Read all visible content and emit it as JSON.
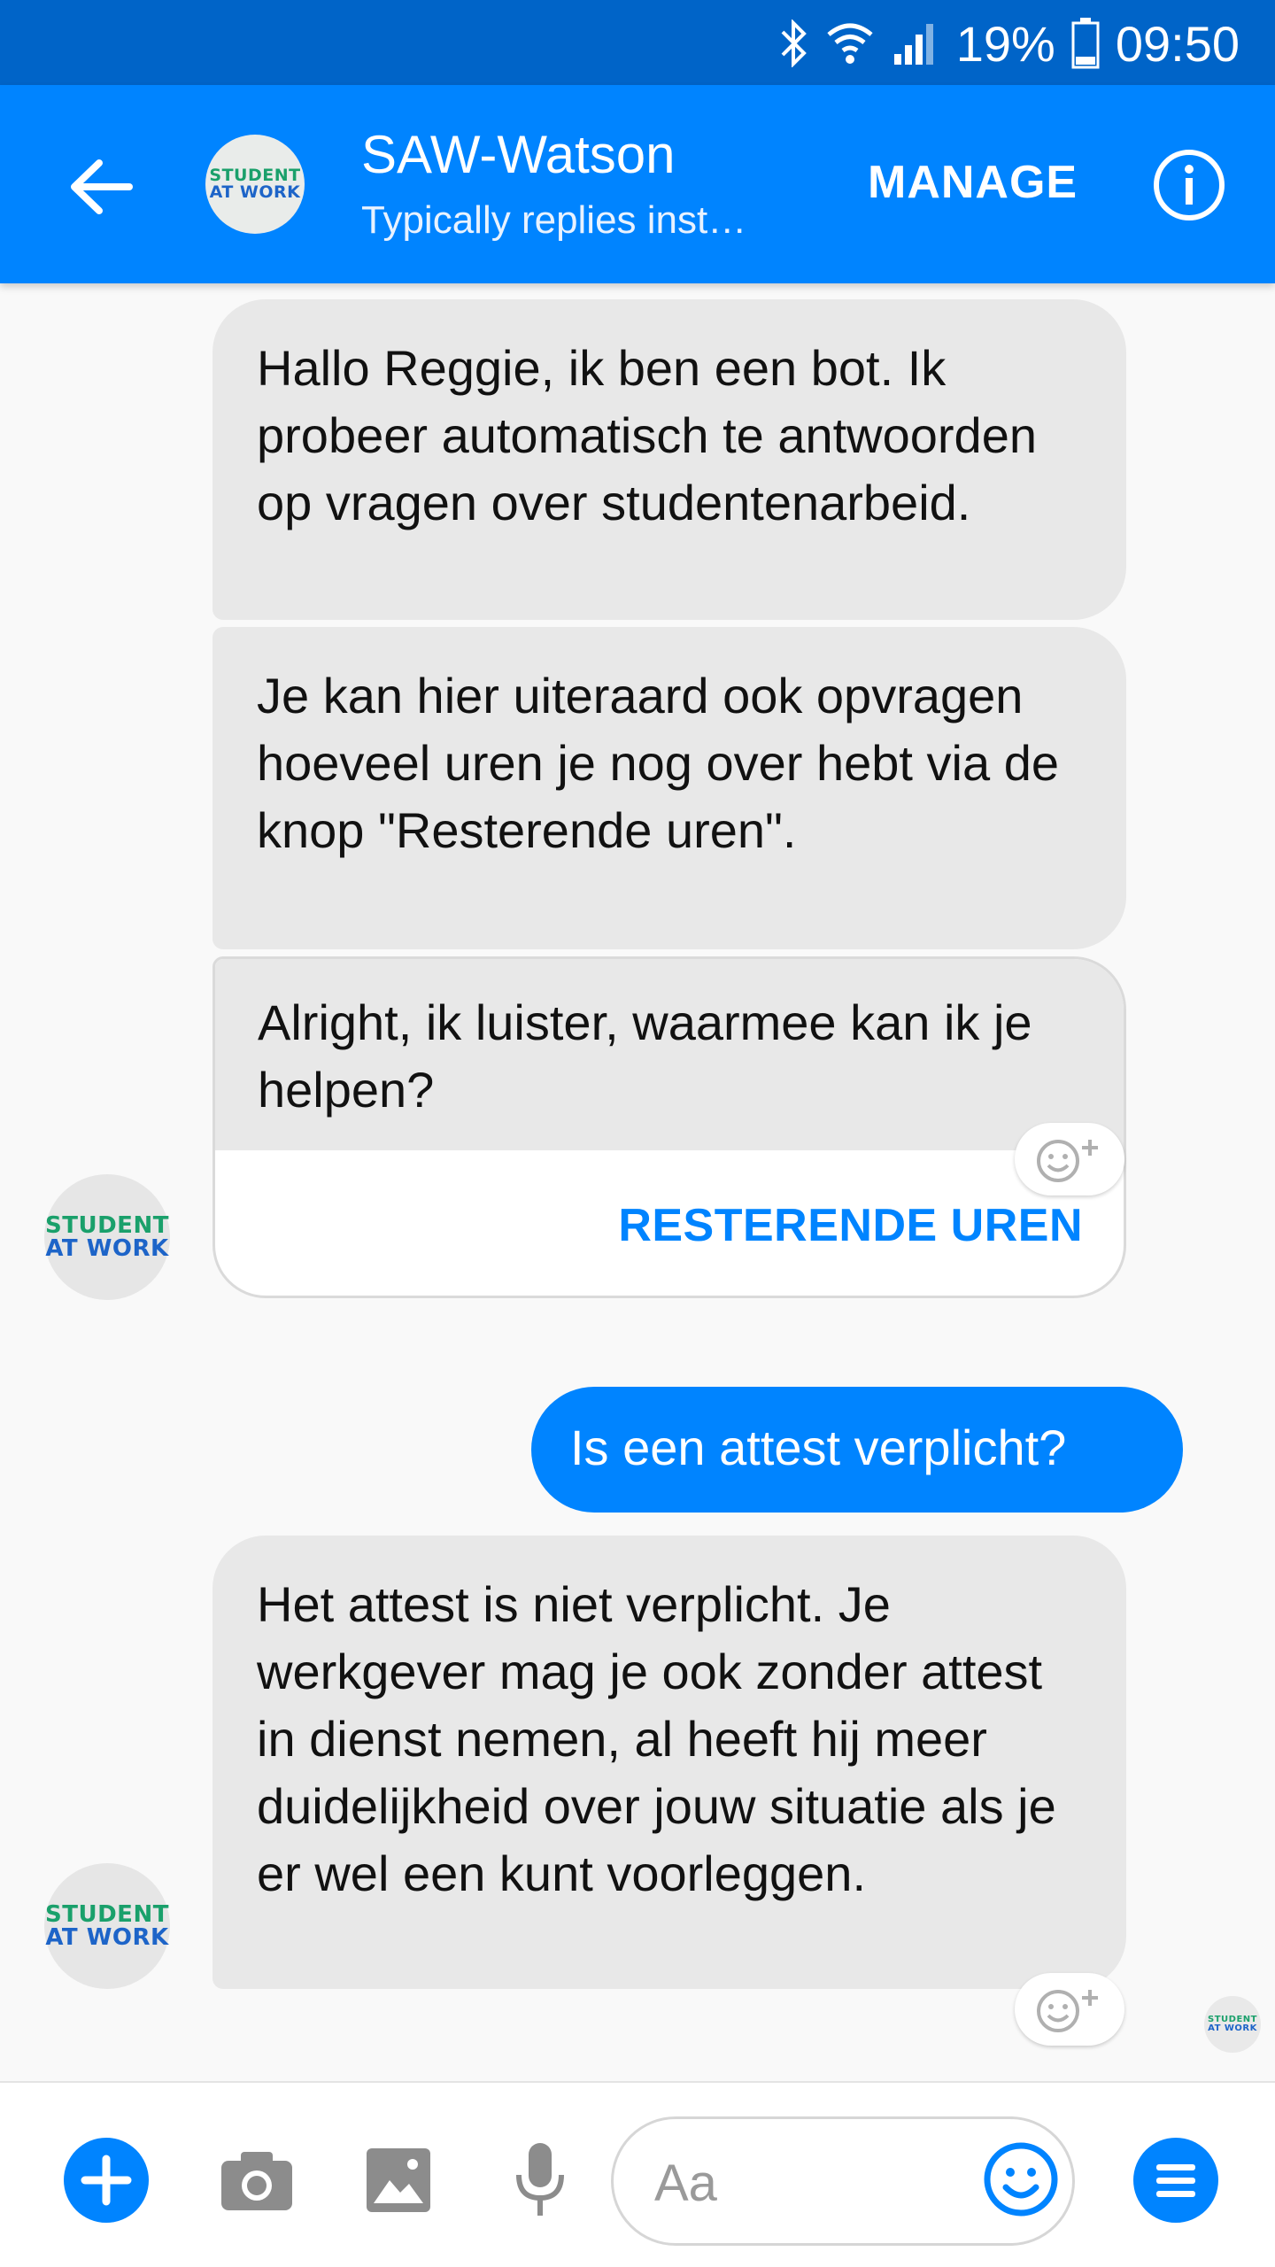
{
  "status_bar": {
    "battery": "19%",
    "time": "09:50",
    "icons": [
      "bluetooth-icon",
      "wifi-icon",
      "signal-icon",
      "battery-icon"
    ]
  },
  "header": {
    "title": "SAW-Watson",
    "subtitle": "Typically replies inst…",
    "manage_label": "MANAGE",
    "avatar_logo": {
      "line1": "STUDENT",
      "line2": "AT WORK"
    },
    "icons": [
      "back-arrow-icon",
      "info-icon"
    ]
  },
  "messages": [
    {
      "from": "bot",
      "text": "Hallo Reggie, ik ben een bot. Ik probeer automatisch te antwoorden op vragen over studentenarbeid."
    },
    {
      "from": "bot",
      "text": "Je kan hier uiteraard ook opvragen hoeveel uren je nog over hebt via de knop \"Resterende uren\"."
    },
    {
      "from": "bot",
      "text": "Alright, ik luister, waarmee kan ik je helpen?",
      "button_label": "RESTERENDE UREN"
    },
    {
      "from": "user",
      "text": "Is een attest verplicht?"
    },
    {
      "from": "bot",
      "text": "Het attest is niet verplicht. Je werkgever mag je ook zonder attest in dienst nemen, al heeft hij meer duidelijkheid over jouw situatie als je er wel een kunt voorleggen."
    }
  ],
  "bot_avatar_logo": {
    "line1": "STUDENT",
    "line2": "AT WORK"
  },
  "composer": {
    "placeholder": "Aa",
    "icons": [
      "plus-icon",
      "camera-icon",
      "image-icon",
      "microphone-icon",
      "emoji-icon",
      "menu-icon"
    ]
  },
  "colors": {
    "status_bar": "#0064c8",
    "header": "#0084ff",
    "accent": "#0084ff",
    "incoming_bubble": "#e8e8e8",
    "outgoing_bubble": "#0084ff"
  }
}
